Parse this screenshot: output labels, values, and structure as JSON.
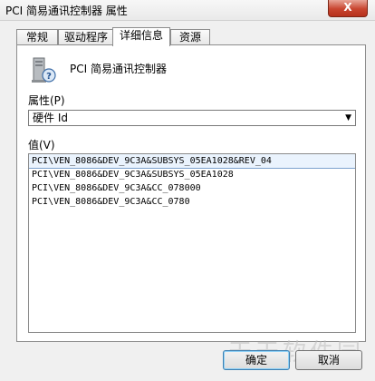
{
  "window": {
    "title": "PCI 简易通讯控制器 属性",
    "close_label": "X"
  },
  "tabs": [
    {
      "label": "常规",
      "active": false
    },
    {
      "label": "驱动程序",
      "active": false
    },
    {
      "label": "详细信息",
      "active": true
    },
    {
      "label": "资源",
      "active": false
    }
  ],
  "device": {
    "name": "PCI 简易通讯控制器",
    "icon": "pci-device-icon"
  },
  "property": {
    "label": "属性(P)",
    "selected": "硬件 Id"
  },
  "value": {
    "label": "值(V)",
    "items": [
      {
        "text": "PCI\\VEN_8086&DEV_9C3A&SUBSYS_05EA1028&REV_04",
        "selected": true
      },
      {
        "text": "PCI\\VEN_8086&DEV_9C3A&SUBSYS_05EA1028",
        "selected": false
      },
      {
        "text": "PCI\\VEN_8086&DEV_9C3A&CC_078000",
        "selected": false
      },
      {
        "text": "PCI\\VEN_8086&DEV_9C3A&CC_0780",
        "selected": false
      }
    ]
  },
  "buttons": {
    "ok": "确定",
    "cancel": "取消"
  },
  "watermark": "天天软件园"
}
